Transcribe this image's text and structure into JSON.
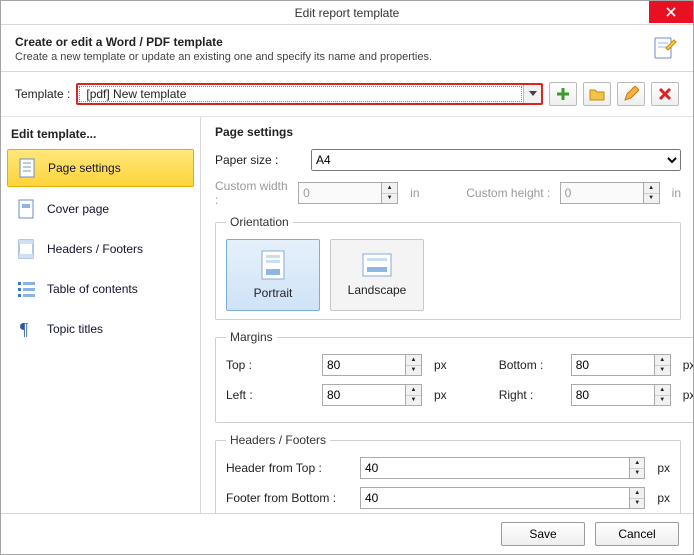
{
  "titlebar": {
    "title": "Edit report template"
  },
  "header": {
    "title": "Create or edit a Word / PDF template",
    "subtitle": "Create a new template or update an existing one and specify its name and properties."
  },
  "template": {
    "label": "Template :",
    "value": "[pdf] New template"
  },
  "sidebar": {
    "header": "Edit template...",
    "items": [
      {
        "label": "Page settings",
        "selected": true
      },
      {
        "label": "Cover page",
        "selected": false
      },
      {
        "label": "Headers / Footers",
        "selected": false
      },
      {
        "label": "Table of contents",
        "selected": false
      },
      {
        "label": "Topic titles",
        "selected": false
      }
    ]
  },
  "page": {
    "header": "Page settings",
    "paperSizeLabel": "Paper size :",
    "paperSize": "A4",
    "customWidth": {
      "label": "Custom width :",
      "value": "0",
      "unit": "in"
    },
    "customHeight": {
      "label": "Custom height :",
      "value": "0",
      "unit": "in"
    },
    "orientation": {
      "legend": "Orientation",
      "portrait": "Portrait",
      "landscape": "Landscape",
      "selected": "portrait"
    },
    "margins": {
      "legend": "Margins",
      "topLabel": "Top :",
      "top": "80",
      "bottomLabel": "Bottom :",
      "bottom": "80",
      "leftLabel": "Left :",
      "left": "80",
      "rightLabel": "Right :",
      "right": "80",
      "unit": "px"
    },
    "hf": {
      "legend": "Headers / Footers",
      "headerLabel": "Header from Top :",
      "header": "40",
      "footerLabel": "Footer from Bottom :",
      "footer": "40",
      "unit": "px"
    }
  },
  "footer": {
    "save": "Save",
    "cancel": "Cancel"
  }
}
